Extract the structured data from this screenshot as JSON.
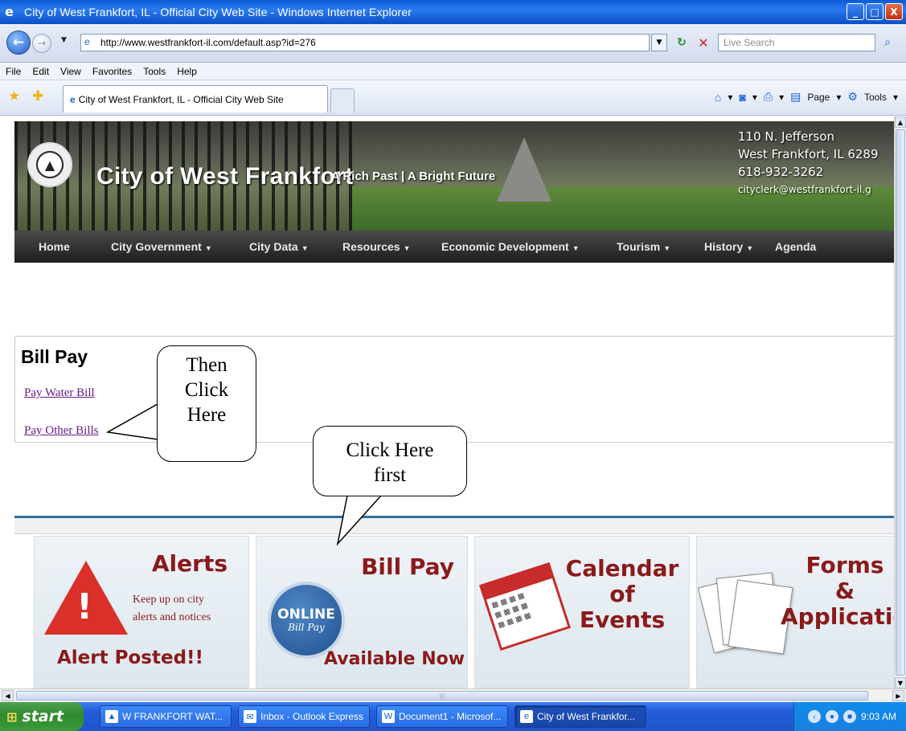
{
  "window": {
    "title": "City of West Frankfort, IL - Official City Web Site - Windows Internet Explorer",
    "minimize": "_",
    "maximize": "□",
    "close": "X"
  },
  "address_bar": {
    "url": "http://www.westfrankfort-il.com/default.asp?id=276",
    "search_placeholder": "Live Search"
  },
  "menu": [
    "File",
    "Edit",
    "View",
    "Favorites",
    "Tools",
    "Help"
  ],
  "tab": {
    "label": "City of West Frankfort, IL - Official City Web Site"
  },
  "command_bar": {
    "page": "Page",
    "tools": "Tools"
  },
  "banner": {
    "site_name": "City of West Frankfort",
    "tagline": "A Rich Past | A Bright Future",
    "address": "110 N. Jefferson",
    "city": "West Frankfort, IL 6289",
    "phone": "618-932-3262",
    "email": "cityclerk@westfrankfort-il.g"
  },
  "site_nav": [
    {
      "label": "Home",
      "dropdown": false
    },
    {
      "label": "City Government",
      "dropdown": true
    },
    {
      "label": "City Data",
      "dropdown": true
    },
    {
      "label": "Resources",
      "dropdown": true
    },
    {
      "label": "Economic Development",
      "dropdown": true
    },
    {
      "label": "Tourism",
      "dropdown": true
    },
    {
      "label": "History",
      "dropdown": true
    },
    {
      "label": "Agenda",
      "dropdown": false
    }
  ],
  "content": {
    "heading": "Bill Pay",
    "links": [
      "Pay Water Bill",
      "Pay Other Bills"
    ]
  },
  "callouts": {
    "then_click": "Then\nClick\nHere",
    "click_first": "Click Here\nfirst"
  },
  "tiles": {
    "alerts": {
      "title": "Alerts",
      "line1": "Keep up on city",
      "line2": "alerts and notices",
      "footer": "Alert Posted!!"
    },
    "billpay": {
      "title": "Bill Pay",
      "badge_top": "ONLINE",
      "badge_bottom": "Bill Pay",
      "footer": "Available Now"
    },
    "calendar": {
      "title_lines": [
        "Calendar",
        "of",
        "Events"
      ]
    },
    "forms": {
      "title_lines": [
        "Forms",
        "&",
        "Application"
      ]
    }
  },
  "taskbar": {
    "start": "start",
    "items": [
      "W FRANKFORT WAT...",
      "Inbox - Outlook Express",
      "Document1 - Microsof...",
      "City of West Frankfor..."
    ],
    "clock": "9:03 AM"
  }
}
